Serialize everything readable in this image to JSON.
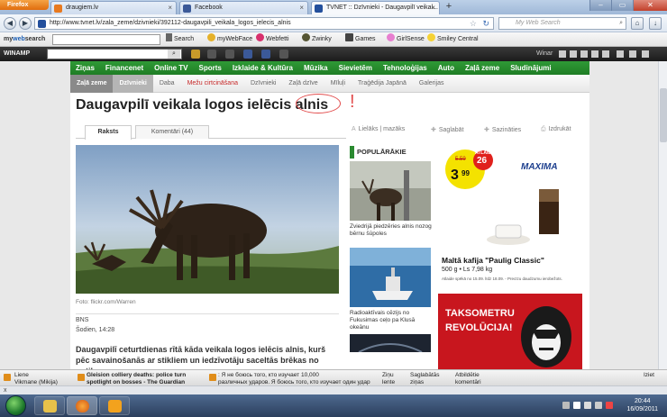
{
  "browser": {
    "button": "Firefox",
    "tabs": [
      {
        "label": "draugiem.lv",
        "color": "#e8791e"
      },
      {
        "label": "Facebook",
        "color": "#3b5998"
      },
      {
        "label": "TVNET :: Dzīvnieki - Daugavpilī veikal...",
        "color": "#234f9c"
      }
    ],
    "new_tab": "+",
    "url": "http://www.tvnet.lv/zala_zeme/dzivnieki/392112-daugavpili_veikala_logos_ielecis_alnis",
    "search_placeholder": "My Web Search"
  },
  "mws_toolbar": {
    "logo_a": "my",
    "logo_b": "web",
    "logo_c": "search",
    "search_button": "Search",
    "items": [
      "myWebFace",
      "Webfetti",
      "Zwinky",
      "Games",
      "GirlSense",
      "Smiley Central"
    ]
  },
  "winamp": {
    "logo": "WINAMP",
    "search_btn": "⌕",
    "winar": "Winar"
  },
  "site": {
    "nav": [
      "Ziņas",
      "Financenet",
      "Online TV",
      "Sports",
      "Izklaide & Kultūra",
      "Mūzika",
      "Sievietēm",
      "Tehnoloģijas",
      "Auto",
      "Zaļā zeme",
      "Sludinājumi"
    ],
    "subnav": [
      "Zaļā zeme",
      "Dzīvnieki",
      "Daba",
      "Mežu cirtcināšana",
      "Dzīvnieki",
      "Zaļā dzīve",
      "Mīluļi",
      "Traģēdija Japānā",
      "Galerijas"
    ],
    "headline": "Daugavpilī veikala logos ielēcis alnis",
    "headline_mark": "!",
    "tabs": {
      "article": "Raksts",
      "comments": "Komentāri (44)"
    },
    "tools": {
      "font": "Lielāks | mazāks",
      "save": "Saglabāt",
      "related": "Sazināties",
      "print": "Izdrukāt"
    },
    "photo_caption": "Foto: flickr.com/Warren",
    "source": "BNS",
    "date": "Šodien, 14:28",
    "lead": "Daugavpilī ceturtdienas rītā kāda veikala logos ielēcis alnis, kurš pēc savainošanās ar stikliem un iedzīvotāju saceltās brēkas no notikuma",
    "popular": {
      "title": "POPULĀRĀKIE RAKSTI",
      "items": [
        "Zviedrijā piedzēries alnis nozog bērnu šūpoles",
        "Radioaktīvais cēzijs no Fukusimas ceļo pa Klusā okeānu"
      ]
    },
    "ad_maxima": {
      "brand": "MAXIMA",
      "old_price": "5.59",
      "discount": "26",
      "discount_label": "ATLAIDE",
      "price_main": "3",
      "price_cents": "99",
      "product": "Maltā kafija \"Paulig Classic\"",
      "weight": "500 g • Ls 7,98 kg",
      "note": "Atlaide spēkā no 15.09. līdz 18.09. - Precīzu daudzumu ierobežots."
    },
    "ad_taxi": {
      "line1": "TAKSOMETRU",
      "line2": "REVOLŪCIJA!"
    }
  },
  "newsbar": [
    {
      "source": "Liene",
      "text": "Vikmane (Mikija)"
    },
    {
      "source": "Gleision colliery deaths: police turn",
      "text": "spotlight on bosses - The Guardian"
    },
    {
      "source": ": Я не боюсь того, кто изучает 10,000",
      "text": "различных ударов. Я боюсь того, кто изучает один удар"
    },
    {
      "source": "Ziņu",
      "text": "lente"
    },
    {
      "source": "Saglabātās",
      "text": "ziņas"
    },
    {
      "source": "Atbildētie",
      "text": "komentāri"
    },
    {
      "source": "Iziet",
      "text": ""
    }
  ],
  "status": "x",
  "clock": {
    "time": "20:44",
    "date": "16/09/2011"
  }
}
